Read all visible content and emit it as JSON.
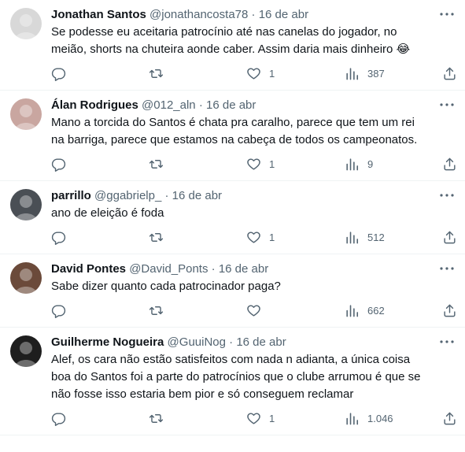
{
  "tweets": [
    {
      "name": "Jonathan Santos",
      "handle": "@jonathancosta78",
      "separator": "·",
      "date": "16 de abr",
      "text": "Se podesse eu aceitaria patrocínio até nas canelas do jogador, no meião, shorts na chuteira aonde caber.  Assim daria mais dinheiro 😂",
      "replies": "",
      "retweets": "",
      "likes": "1",
      "views": "387",
      "avatar_color": "#d8d8d8"
    },
    {
      "name": "Álan Rodrigues",
      "handle": "@012_aln",
      "separator": "·",
      "date": "16 de abr",
      "text": "Mano a torcida do Santos é chata pra caralho, parece que tem um rei na barriga, parece que estamos na cabeça de todos os campeonatos.",
      "replies": "",
      "retweets": "",
      "likes": "1",
      "views": "9",
      "avatar_color": "#c9a6a0"
    },
    {
      "name": "parrillo",
      "handle": "@ggabrielp_",
      "separator": "·",
      "date": "16 de abr",
      "text": "ano de eleição é foda",
      "replies": "",
      "retweets": "",
      "likes": "1",
      "views": "512",
      "avatar_color": "#4a4f55"
    },
    {
      "name": "David Pontes",
      "handle": "@David_Ponts",
      "separator": "·",
      "date": "16 de abr",
      "text": "Sabe dizer quanto cada patrocinador paga?",
      "replies": "",
      "retweets": "",
      "likes": "",
      "views": "662",
      "avatar_color": "#6b4a3a"
    },
    {
      "name": "Guilherme Nogueira",
      "handle": "@GuuiNog",
      "separator": "·",
      "date": "16 de abr",
      "text": "Alef, os cara não estão satisfeitos com nada n adianta, a única coisa boa do Santos foi a parte do patrocínios que o clube arrumou é que se não fosse isso estaria bem pior e só conseguem reclamar",
      "replies": "",
      "retweets": "",
      "likes": "1",
      "views": "1.046",
      "avatar_color": "#1e1e1e"
    }
  ],
  "colors": {
    "text": "#0f1419",
    "secondary": "#536471",
    "border": "#eff3f4"
  }
}
